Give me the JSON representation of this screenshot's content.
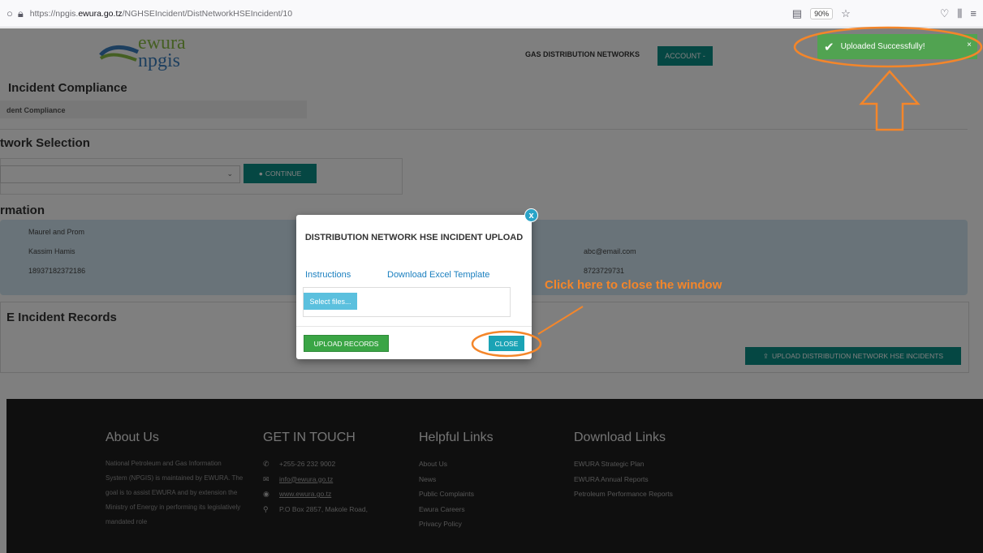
{
  "browser": {
    "url_prefix": "https://npgis.",
    "url_domain": "ewura.go.tz",
    "url_path": "/NGHSEIncident/DistNetworkHSEIncident/10",
    "zoom": "90%"
  },
  "header": {
    "logo_line1": "ewura",
    "logo_line2": "npgis",
    "nav_link": "GAS DISTRIBUTION NETWORKS",
    "account_label": "ACCOUNT -"
  },
  "page": {
    "section1_title": "Incident Compliance",
    "section1_tab": "dent Compliance",
    "section2_title": "twork Selection",
    "continue_label": "CONTINUE",
    "section3_title": "rmation",
    "info": {
      "left_line1": "Maurel and Prom",
      "left_line2": "Kassim Hamis",
      "left_line3": "18937182372186",
      "right_line1": "abc@email.com",
      "right_line2": "8723729731"
    },
    "section4_title": "E Incident Records",
    "upload_hse_label": "UPLOAD DISTRIBUTION NETWORK HSE INCIDENTS"
  },
  "footer": {
    "about_title": "About Us",
    "about_text": "National Petroleum and Gas Information System (NPGIS) is maintained by EWURA. The goal is to assist EWURA and by extension the Ministry of Energy in performing its legislatively mandated role",
    "touch_title": "GET IN TOUCH",
    "touch_phone": "+255-26 232 9002",
    "touch_email": "info@ewura.go.tz",
    "touch_web": "www.ewura.go.tz",
    "touch_address": "P.O Box 2857, Makole Road,",
    "helpful_title": "Helpful Links",
    "helpful_links": [
      "About Us",
      "News",
      "Public Complaints",
      "Ewura Careers",
      "Privacy Policy"
    ],
    "download_title": "Download Links",
    "download_links": [
      "EWURA Strategic Plan",
      "EWURA Annual Reports",
      "Petroleum Performance Reports"
    ]
  },
  "modal": {
    "title": "DISTRIBUTION NETWORK HSE INCIDENT UPLOAD",
    "instructions_link": "Instructions",
    "template_link": "Download Excel Template",
    "select_files_label": "Select files...",
    "upload_records_label": "UPLOAD RECORDS",
    "close_label": "CLOSE",
    "close_x": "x"
  },
  "toast": {
    "message": "Uploaded Successfully!",
    "close": "×"
  },
  "annotation": {
    "text": "Click here to close the window",
    "color": "#f4862a"
  }
}
